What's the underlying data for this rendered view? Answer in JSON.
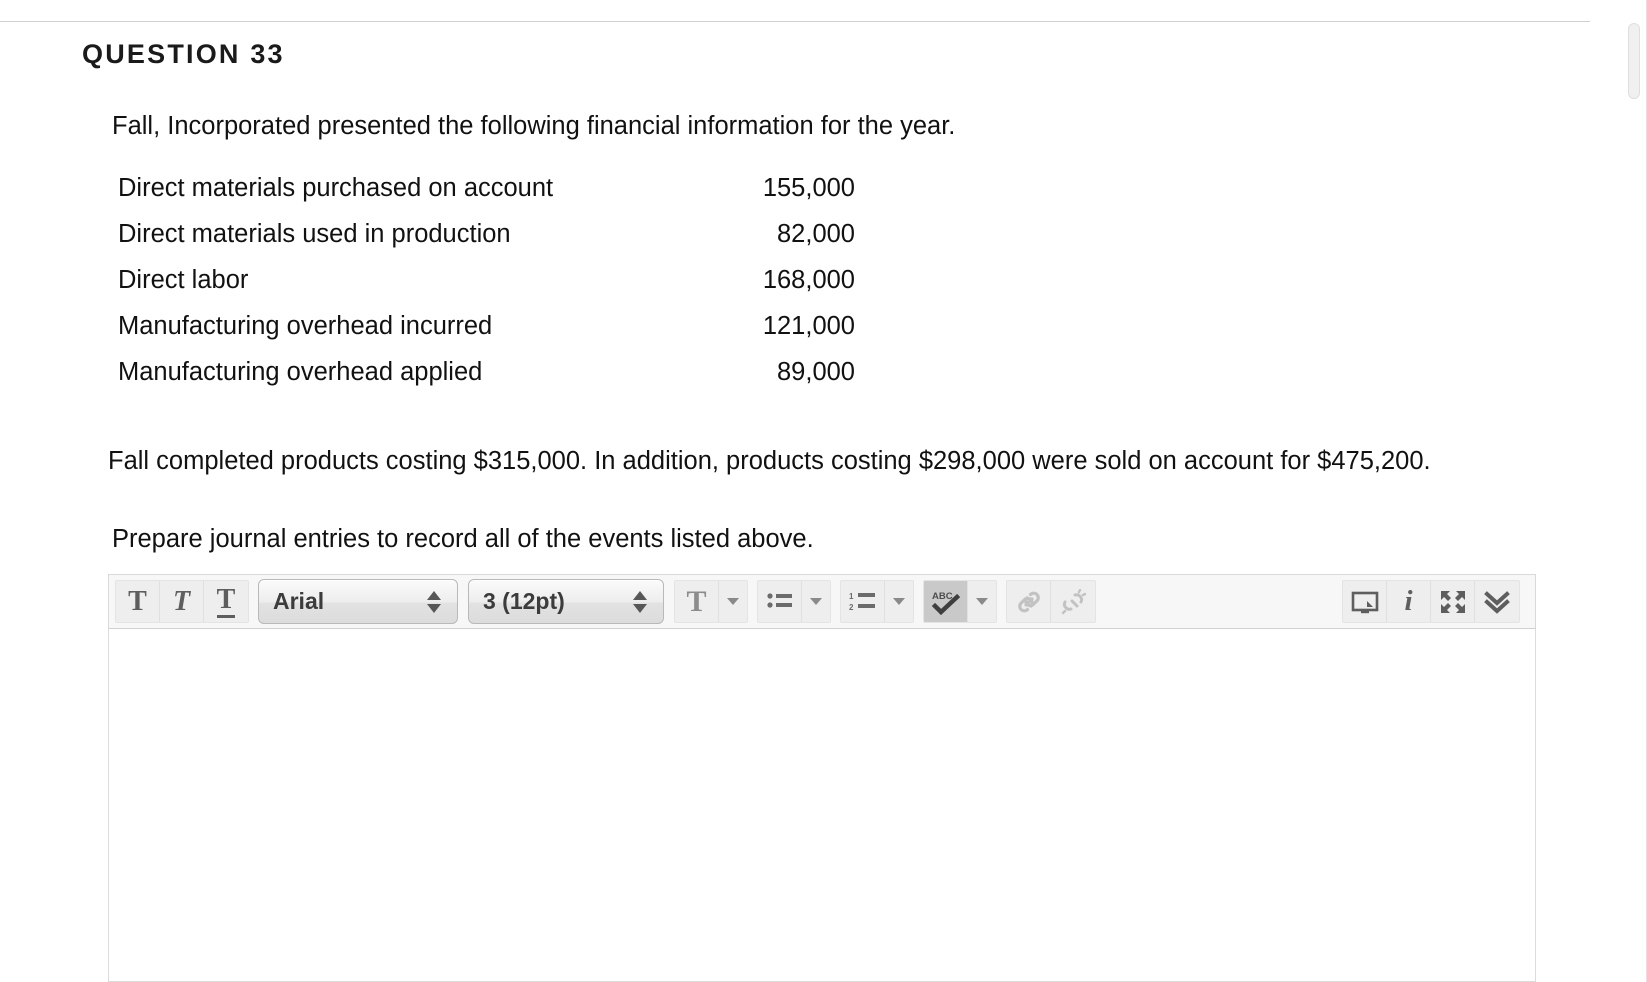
{
  "page": {
    "heading": "QUESTION 33",
    "intro": "Fall, Incorporated presented the following financial information for the year.",
    "paragraph_1": "Fall completed products costing $315,000.  In addition, products costing $298,000 were sold on account for $475,200.",
    "paragraph_2": "Prepare journal entries to record all of the events listed above."
  },
  "financials": {
    "rows": [
      {
        "label": "Direct materials purchased on account",
        "amount": "155,000"
      },
      {
        "label": "Direct materials used in production",
        "amount": "82,000"
      },
      {
        "label": "Direct labor",
        "amount": "168,000"
      },
      {
        "label": "Manufacturing overhead incurred",
        "amount": "121,000"
      },
      {
        "label": "Manufacturing overhead applied",
        "amount": "89,000"
      }
    ]
  },
  "editor": {
    "toolbar": {
      "bold_label": "T",
      "italic_label": "T",
      "underline_label": "T",
      "font_family_value": "Arial",
      "font_size_value": "3 (12pt)",
      "text_color_label": "T",
      "spellcheck_label": "ABC",
      "info_label": "i"
    },
    "body_value": ""
  },
  "colors": {
    "toolbar_background": "#f7f7f7",
    "button_background": "#eeeeee",
    "button_active_background": "#c9c9c9",
    "icon_gray": "#5e5e5e",
    "border_gray": "#d9d9d9",
    "text_black": "#111111"
  }
}
